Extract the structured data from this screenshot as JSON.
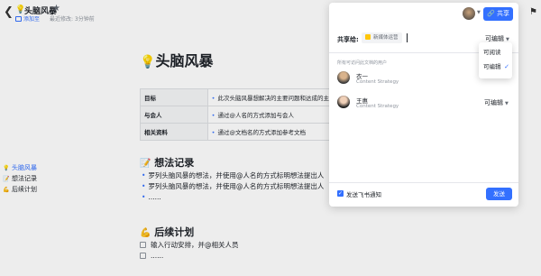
{
  "doc": {
    "back_icon": "chevron-left-icon",
    "title": "头脑风暴",
    "title_icon": "lightbulb-icon",
    "star_icon": "star-icon",
    "tag_link": "添加至",
    "modified": "最近修改: 3分钟前",
    "present_icon": "trophy-icon",
    "heading": "头脑风暴",
    "table": [
      {
        "key": "目标",
        "value": "此次头脑风暴想解决的主要问题和达成的主"
      },
      {
        "key": "与会人",
        "value": "通过@人名的方式添加与会人"
      },
      {
        "key": "相关资料",
        "value": "通过@文档名的方式添加参考文档"
      }
    ],
    "section_ideas": {
      "emoji": "📝",
      "title": "想法记录"
    },
    "ideas": [
      "罗列头脑风暴的想法，并使用@人名的方式标明想法提出人",
      "罗列头脑风暴的想法，并使用@人名的方式标明想法提出人",
      "......"
    ],
    "section_plan": {
      "emoji": "💪",
      "title": "后续计划"
    },
    "todos": [
      "输入行动安排，并@相关人员",
      "......"
    ]
  },
  "outline": [
    {
      "icon": "💡",
      "label": "头脑风暴",
      "active": true
    },
    {
      "icon": "📝",
      "label": "想法记录",
      "active": false
    },
    {
      "icon": "💪",
      "label": "后续计划",
      "active": false
    }
  ],
  "share_panel": {
    "share_button": "共享",
    "share_to_label": "共享给:",
    "invitee_chip": "新媒体运营",
    "permission": "可编辑",
    "section_label": "所有可访问此文档的用户",
    "members": [
      {
        "name": "衣一",
        "role": "Content Strategy",
        "permission": "可编辑"
      },
      {
        "name": "王惠",
        "role": "Content Strategy",
        "permission": "可编辑"
      }
    ],
    "notify_label": "发送飞书通知",
    "send_button": "发送"
  },
  "permission_dropdown": {
    "options": [
      "可阅读",
      "可编辑"
    ],
    "selected": "可编辑"
  },
  "colors": {
    "accent": "#3370ff",
    "text": "#1f2329",
    "muted": "#8f959e"
  }
}
